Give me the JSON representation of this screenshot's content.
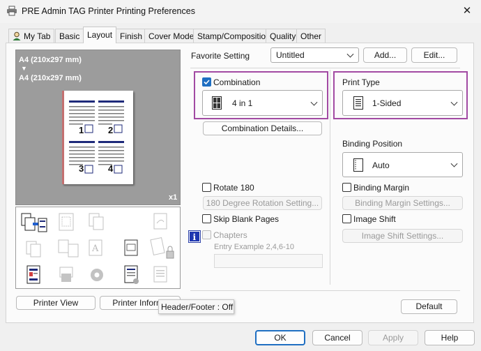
{
  "window": {
    "title": "PRE Admin TAG Printer Printing Preferences",
    "close_glyph": "✕"
  },
  "tabs": [
    {
      "label": "My Tab"
    },
    {
      "label": "Basic"
    },
    {
      "label": "Layout"
    },
    {
      "label": "Finish"
    },
    {
      "label": "Cover Mode"
    },
    {
      "label": "Stamp/Composition"
    },
    {
      "label": "Quality"
    },
    {
      "label": "Other"
    }
  ],
  "active_tab": "Layout",
  "preview": {
    "original_size": "A4 (210x297 mm)",
    "arrow": "▼",
    "output_size": "A4 (210x297 mm)",
    "copies": "x1",
    "page_numbers": [
      "1",
      "2",
      "3",
      "4"
    ]
  },
  "favorite": {
    "label": "Favorite Setting",
    "value": "Untitled",
    "add_label": "Add...",
    "edit_label": "Edit..."
  },
  "combination": {
    "label": "Combination",
    "checked": true,
    "value": "4 in 1",
    "details_label": "Combination Details..."
  },
  "print_type": {
    "label": "Print Type",
    "value": "1-Sided"
  },
  "binding_position": {
    "label": "Binding Position",
    "value": "Auto"
  },
  "rotate180": {
    "label": "Rotate 180",
    "checked": false,
    "settings_label": "180 Degree Rotation Setting..."
  },
  "skip_blank": {
    "label": "Skip Blank Pages",
    "checked": false
  },
  "chapters": {
    "label": "Chapters",
    "checked": false,
    "example": "Entry Example 2,4,6-10",
    "value": ""
  },
  "binding_margin": {
    "label": "Binding Margin",
    "checked": false,
    "settings_label": "Binding Margin Settings..."
  },
  "image_shift": {
    "label": "Image Shift",
    "checked": false,
    "settings_label": "Image Shift Settings..."
  },
  "bottom": {
    "printer_view": "Printer View",
    "printer_info": "Printer Informa",
    "tooltip": "Header/Footer : Off",
    "default": "Default"
  },
  "footer": {
    "ok": "OK",
    "cancel": "Cancel",
    "apply": "Apply",
    "help": "Help"
  },
  "colors": {
    "accent": "#1f6fc2",
    "highlight": "#a24aa3",
    "preview_bg": "#9c9c9c"
  }
}
